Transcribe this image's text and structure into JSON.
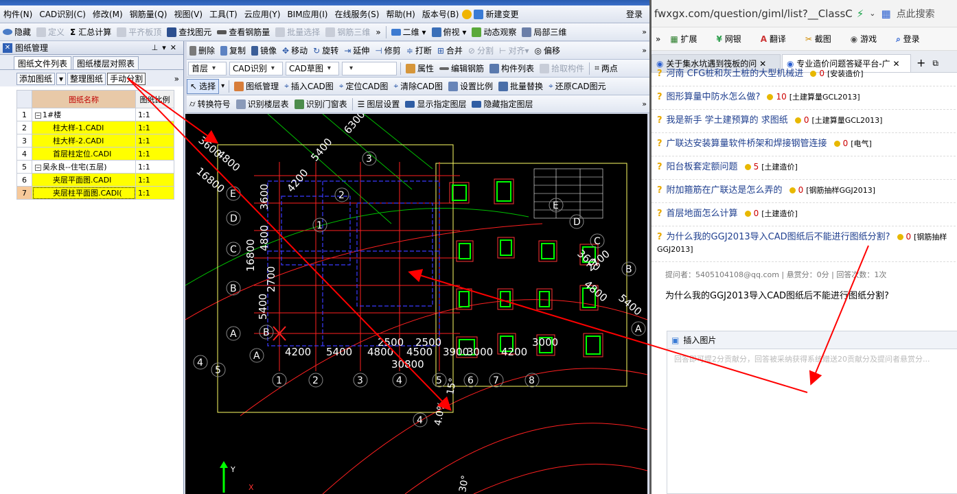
{
  "menubar": {
    "items": [
      "构件(N)",
      "CAD识别(C)",
      "修改(M)",
      "钢筋量(Q)",
      "视图(V)",
      "工具(T)",
      "云应用(Y)",
      "BIM应用(I)",
      "在线服务(S)",
      "帮助(H)",
      "版本号(B)",
      "新建变更"
    ],
    "login": "登录"
  },
  "toolbar1": {
    "items": [
      {
        "label": "隐藏",
        "enabled": true
      },
      {
        "label": "定义",
        "enabled": false
      },
      {
        "label": "汇总计算",
        "enabled": true
      },
      {
        "label": "平齐板顶",
        "enabled": false
      },
      {
        "label": "查找图元",
        "enabled": true
      },
      {
        "label": "查看钢筋量",
        "enabled": true
      },
      {
        "label": "批量选择",
        "enabled": false
      },
      {
        "label": "钢筋三维",
        "enabled": false
      }
    ],
    "right_items": [
      "二维",
      "俯视",
      "动态观察",
      "局部三维"
    ]
  },
  "toolbar2": {
    "items": [
      "删除",
      "复制",
      "镜像",
      "移动",
      "旋转",
      "延伸",
      "修剪",
      "打断",
      "合并",
      "分割",
      "对齐",
      "偏移"
    ]
  },
  "toolbar3": {
    "floor": "首层",
    "mode": "CAD识别",
    "layer": "CAD草图",
    "items": [
      "属性",
      "编辑钢筋",
      "构件列表",
      "拾取构件",
      "两点"
    ]
  },
  "toolbar4": {
    "select": "选择",
    "items": [
      "图纸管理",
      "插入CAD图",
      "定位CAD图",
      "清除CAD图",
      "设置比例",
      "批量替换",
      "还原CAD图元"
    ]
  },
  "toolbar5": {
    "items": [
      "转换符号",
      "识别楼层表",
      "识别门窗表",
      "图层设置",
      "显示指定图层",
      "隐藏指定图层"
    ]
  },
  "panel": {
    "title": "图纸管理",
    "tabs": [
      "图纸文件列表",
      "图纸楼层对照表"
    ],
    "buttons": [
      "添加图纸",
      "整理图纸",
      "手动分割"
    ],
    "col_name": "图纸名称",
    "col_scale": "图纸比例",
    "rows": [
      {
        "n": "1",
        "name": "1#楼",
        "scale": "1:1",
        "group": true,
        "hl": false
      },
      {
        "n": "2",
        "name": "柱大样-1.CADI",
        "scale": "1:1",
        "group": false,
        "hl": true
      },
      {
        "n": "3",
        "name": "柱大样-2.CADI",
        "scale": "1:1",
        "group": false,
        "hl": true
      },
      {
        "n": "4",
        "name": "首层柱定位.CADI",
        "scale": "1:1",
        "group": false,
        "hl": true
      },
      {
        "n": "5",
        "name": "吴永良--住宅(五层)",
        "scale": "1:1",
        "group": true,
        "hl": false
      },
      {
        "n": "6",
        "name": "夹层平面图.CADI",
        "scale": "1:1",
        "group": false,
        "hl": true
      },
      {
        "n": "7",
        "name": "夹层柱平面图.CADI(",
        "scale": "1:1",
        "group": false,
        "hl": true
      }
    ]
  },
  "browser": {
    "url": "fwxgx.com/question/giml/list?__ClassC",
    "search_placeholder": "点此搜索",
    "bookmarks": [
      "扩展",
      "网银",
      "翻译",
      "截图",
      "游戏",
      "登录"
    ],
    "tabs": [
      "关于集水坑遇到筏板的问",
      "专业造价问题答疑平台-广"
    ],
    "questions": [
      {
        "title": "河南 CFG桩和灰土桩的大型机械进",
        "points": "0",
        "category": "[安装造价]"
      },
      {
        "title": "图形算量中防水怎么做?",
        "points": "10",
        "category": "[土建算量GCL2013]"
      },
      {
        "title": "我是新手 学土建预算的 求图纸",
        "points": "0",
        "category": "[土建算量GCL2013]"
      },
      {
        "title": "广联达安装算量软件桥架和焊接钢管连接",
        "points": "0",
        "category": "[电气]"
      },
      {
        "title": "阳台板套定额问题",
        "points": "5",
        "category": "[土建造价]"
      },
      {
        "title": "附加箍筋在广联达是怎么弄的",
        "points": "0",
        "category": "[钢筋抽样GGJ2013]"
      },
      {
        "title": "首层地面怎么计算",
        "points": "0",
        "category": "[土建造价]"
      },
      {
        "title": "为什么我的GGJ2013导入CAD图纸后不能进行图纸分割?",
        "points": "0",
        "category": "[钢筋抽样GGJ2013]"
      }
    ],
    "meta": "提问者：5405104108@qq.com  |  悬赏分：0分  |  回答次数：1次",
    "question_text": "为什么我的GGJ2013导入CAD图纸后不能进行图纸分割?",
    "insert_image": "插入图片",
    "answer_placeholder": "回答即可提2分贡献分，回答被采纳获得系统赠送20贡献分及提问者悬赏分..."
  },
  "cad": {
    "dims": [
      "4200",
      "5400",
      "4800",
      "4500",
      "3900",
      "3000",
      "4200",
      "2500",
      "2500",
      "30800",
      "2700",
      "16800",
      "4800",
      "3600",
      "5400",
      "4200",
      "3600",
      "16800",
      "4800",
      "5400",
      "6300",
      "3000",
      "3600",
      "2700",
      "4800",
      "5400"
    ],
    "axis_nums": [
      "1",
      "2",
      "3",
      "4",
      "5",
      "6",
      "7",
      "8",
      "1",
      "2",
      "3",
      "4",
      "5",
      "4"
    ],
    "axis_letters": [
      "A",
      "B",
      "C",
      "D",
      "E",
      "A",
      "B",
      "C",
      "D",
      "E",
      "A",
      "B"
    ],
    "bottom_labels": [
      "15°",
      "30°",
      "4.0%"
    ],
    "colors": {
      "bg": "#000000",
      "grid": "#ff0000",
      "blue": "#3030ff",
      "green": "#00ff00",
      "white": "#ffffff",
      "yellow": "#ffff00"
    }
  }
}
